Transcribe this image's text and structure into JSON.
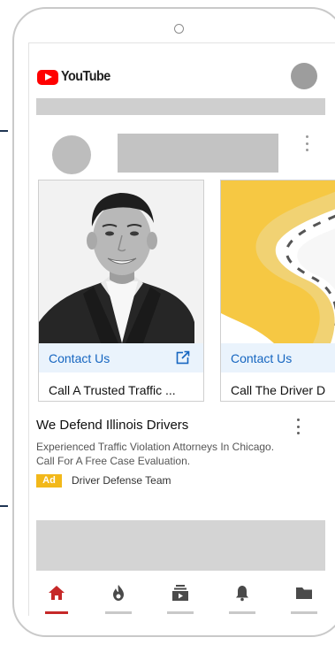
{
  "app": {
    "logo_text": "YouTube"
  },
  "ad": {
    "cards": [
      {
        "cta_label": "Contact Us",
        "title": "Call A Trusted Traffic ...",
        "image": "attorney-photo",
        "icon": "open-external-icon"
      },
      {
        "cta_label": "Contact Us",
        "title": "Call The Driver D",
        "image": "winding-road-illustration"
      }
    ],
    "headline": "We Defend Illinois Drivers",
    "description": "Experienced Traffic Violation Attorneys In Chicago. Call For A Free Case Evaluation.",
    "badge": "Ad",
    "advertiser": "Driver Defense Team"
  },
  "bottom_nav": {
    "items": [
      {
        "icon": "home-icon",
        "active": true
      },
      {
        "icon": "trending-flame-icon",
        "active": false
      },
      {
        "icon": "subscriptions-icon",
        "active": false
      },
      {
        "icon": "notifications-bell-icon",
        "active": false
      },
      {
        "icon": "library-folder-icon",
        "active": false
      }
    ]
  },
  "colors": {
    "brand_red": "#ff0000",
    "link_blue": "#1565c0",
    "cta_background": "#eaf3fc",
    "ad_badge": "#f2b81a",
    "nav_active": "#c62828",
    "road_yellow": "#f6c843"
  }
}
